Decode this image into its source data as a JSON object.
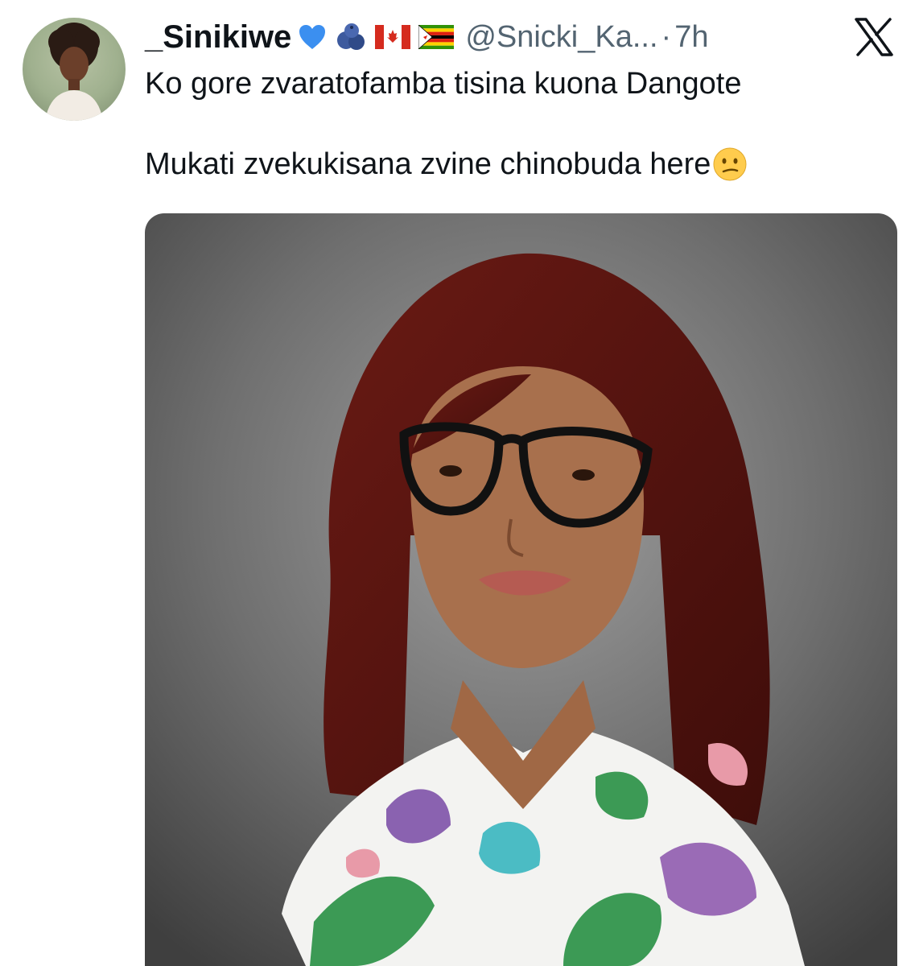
{
  "tweet": {
    "display_name": "_Sinikiwe",
    "badges": [
      "blue-heart-icon",
      "blueberries-icon",
      "canada-flag-icon",
      "zimbabwe-flag-icon"
    ],
    "handle": "@Snicki_Ka...",
    "separator": "·",
    "time": "7h",
    "text_line_1": "Ko gore zvaratofamba tisina kuona Dangote",
    "text_line_2": "Mukati zvekukisana zvine chinobuda here",
    "text_line_2_emoji": "confused-face-emoji"
  },
  "colors": {
    "text_primary": "#0f1419",
    "text_secondary": "#536471"
  }
}
